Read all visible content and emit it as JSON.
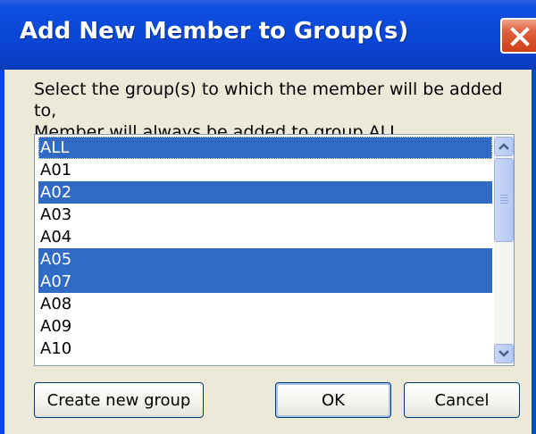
{
  "window": {
    "title": "Add New Member to Group(s)"
  },
  "instructions": {
    "line1": "Select the group(s) to which the member will be added to,",
    "line2": "Member will always be added to group ALL ."
  },
  "groups": [
    {
      "label": "ALL",
      "selected": true
    },
    {
      "label": "A01",
      "selected": false
    },
    {
      "label": "A02",
      "selected": true
    },
    {
      "label": "A03",
      "selected": false
    },
    {
      "label": "A04",
      "selected": false
    },
    {
      "label": "A05",
      "selected": true
    },
    {
      "label": "A07",
      "selected": true
    },
    {
      "label": "A08",
      "selected": false
    },
    {
      "label": "A09",
      "selected": false
    },
    {
      "label": "A10",
      "selected": false
    }
  ],
  "buttons": {
    "create_label": "Create new group",
    "ok_label": "OK",
    "cancel_label": "Cancel"
  },
  "colors": {
    "titlebar": "#0a46d6",
    "selection": "#316ac5",
    "dialog_bg": "#ece9d8",
    "close_button": "#e0623e"
  },
  "icons": {
    "close": "close-icon",
    "scroll_up": "chevron-up-icon",
    "scroll_down": "chevron-down-icon"
  }
}
